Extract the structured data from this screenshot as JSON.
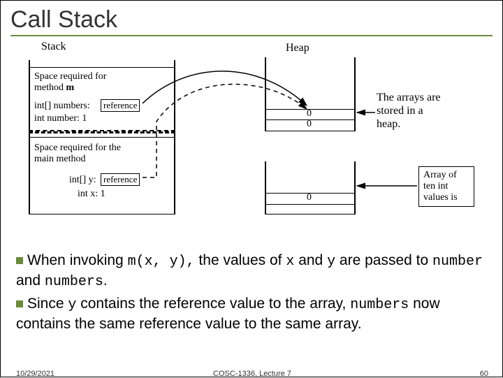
{
  "title": "Call Stack",
  "diagram": {
    "stack_label": "Stack",
    "heap_label": "Heap",
    "m_block": {
      "line1": "Space required for",
      "line2": "method m",
      "numbers_label": "int[] numbers:",
      "reference_box": "reference",
      "number_label": "int number: 1"
    },
    "main_block": {
      "line1": "Space required for the",
      "line2": "main method",
      "y_label": "int[] y:",
      "reference_box": "reference",
      "x_label": "int x: 1"
    },
    "heap_top_values": [
      "0",
      "0"
    ],
    "heap_bottom_value": "0",
    "heap_note": "The arrays are\nstored in a\nheap.",
    "array_box": "Array of\nten int\nvalues is"
  },
  "bullets": {
    "b1_pre": "When invoking ",
    "b1_code1": "m(x, y),",
    "b1_mid": " the values of ",
    "b1_code2": "x",
    "b1_mid2": " and ",
    "b1_code3": "y",
    "b1_mid3": " are passed to ",
    "b1_code4": "number",
    "b1_mid4": " and ",
    "b1_code5": "numbers",
    "b1_end": ".",
    "b2_pre": "Since ",
    "b2_code1": "y",
    "b2_mid": " contains the reference value to the array, ",
    "b2_code2": "numbers",
    "b2_end": " now contains the same reference value to the same array."
  },
  "footer": {
    "date": "10/29/2021",
    "course": "COSC-1336, Lecture 7",
    "page": "60"
  }
}
